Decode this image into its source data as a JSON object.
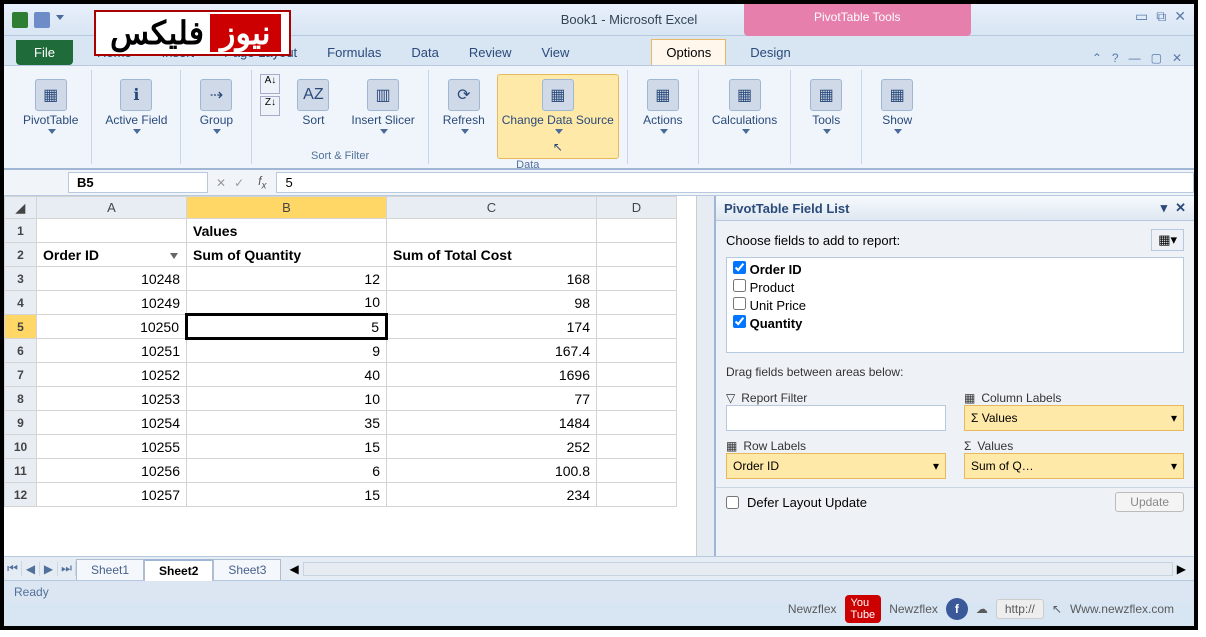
{
  "window": {
    "title": "Book1 - Microsoft Excel",
    "context_title": "PivotTable Tools"
  },
  "logo": {
    "red": "نیوز",
    "black": "فلیکس"
  },
  "tabs": {
    "file": "File",
    "items": [
      "Home",
      "Insert",
      "Page Layout",
      "Formulas",
      "Data",
      "Review",
      "View"
    ],
    "context": {
      "options": "Options",
      "design": "Design"
    }
  },
  "ribbon": {
    "pivottable": "PivotTable",
    "active_field": "Active Field",
    "group": "Group",
    "sort": "Sort",
    "insert_slicer": "Insert Slicer",
    "refresh": "Refresh",
    "change_source": "Change Data Source",
    "actions": "Actions",
    "calculations": "Calculations",
    "tools": "Tools",
    "show": "Show",
    "group_sortfilter": "Sort & Filter",
    "group_data": "Data"
  },
  "formula": {
    "cellref": "B5",
    "value": "5"
  },
  "columns": [
    "A",
    "B",
    "C",
    "D"
  ],
  "headers": {
    "values_label": "Values",
    "order_id": "Order ID",
    "sum_qty": "Sum of Quantity",
    "sum_cost": "Sum of Total Cost"
  },
  "rows": [
    {
      "n": 3,
      "a": "10248",
      "b": "12",
      "c": "168"
    },
    {
      "n": 4,
      "a": "10249",
      "b": "10",
      "c": "98"
    },
    {
      "n": 5,
      "a": "10250",
      "b": "5",
      "c": "174"
    },
    {
      "n": 6,
      "a": "10251",
      "b": "9",
      "c": "167.4"
    },
    {
      "n": 7,
      "a": "10252",
      "b": "40",
      "c": "1696"
    },
    {
      "n": 8,
      "a": "10253",
      "b": "10",
      "c": "77"
    },
    {
      "n": 9,
      "a": "10254",
      "b": "35",
      "c": "1484"
    },
    {
      "n": 10,
      "a": "10255",
      "b": "15",
      "c": "252"
    },
    {
      "n": 11,
      "a": "10256",
      "b": "6",
      "c": "100.8"
    },
    {
      "n": 12,
      "a": "10257",
      "b": "15",
      "c": "234"
    }
  ],
  "pane": {
    "title": "PivotTable Field List",
    "prompt": "Choose fields to add to report:",
    "fields": [
      {
        "name": "Order ID",
        "checked": true,
        "bold": true
      },
      {
        "name": "Product",
        "checked": false,
        "bold": false
      },
      {
        "name": "Unit Price",
        "checked": false,
        "bold": false
      },
      {
        "name": "Quantity",
        "checked": true,
        "bold": true
      }
    ],
    "drag_prompt": "Drag fields between areas below:",
    "areas": {
      "report_filter": "Report Filter",
      "column_labels": "Column Labels",
      "row_labels": "Row Labels",
      "values": "Values",
      "col_val": "Σ  Values",
      "row_val": "Order ID",
      "vals_val": "Sum of Q…"
    },
    "defer": "Defer Layout Update",
    "update": "Update"
  },
  "sheets": {
    "s1": "Sheet1",
    "s2": "Sheet2",
    "s3": "Sheet3"
  },
  "status": "Ready",
  "watermark": {
    "nf": "Newzflex",
    "url": "http://",
    "site": "Www.newzflex.com"
  }
}
